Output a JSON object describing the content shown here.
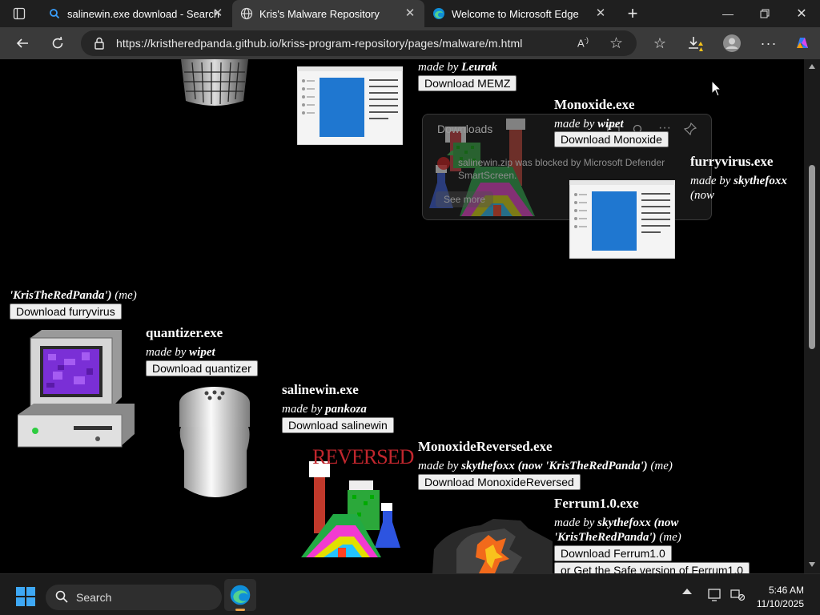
{
  "tabs": [
    {
      "title": "salinewin.exe download - Search",
      "active": false
    },
    {
      "title": "Kris's Malware Repository",
      "active": true
    },
    {
      "title": "Welcome to Microsoft Edge",
      "active": false
    }
  ],
  "address_bar": {
    "url": "https://kristheredpanda.github.io/kriss-program-repository/pages/malware/m.html"
  },
  "download_panel": {
    "title": "Downloads",
    "message": "salinewin.zip was blocked by Microsoft Defender SmartScreen.",
    "see_more": "See more"
  },
  "entries": [
    {
      "id": "memz",
      "title": "",
      "author_prefix": "made by",
      "author": "Leurak",
      "author_suffix": "",
      "button": "Download MEMZ"
    },
    {
      "id": "monoxide",
      "title": "Monoxide.exe",
      "author_prefix": "made by",
      "author": "wipet",
      "author_suffix": "",
      "button": "Download Monoxide"
    },
    {
      "id": "furryvirus",
      "title": "furryvirus.exe",
      "author_prefix": "made by",
      "author": "skythefoxx",
      "author_suffix": "(now",
      "author_line2": "'KrisTheRedPanda')",
      "author_line2_suffix": "(me)",
      "button": "Download furryvirus"
    },
    {
      "id": "quantizer",
      "title": "quantizer.exe",
      "author_prefix": "made by",
      "author": "wipet",
      "author_suffix": "",
      "button": "Download quantizer"
    },
    {
      "id": "salinewin",
      "title": "salinewin.exe",
      "author_prefix": "made by",
      "author": "pankoza",
      "author_suffix": "",
      "button": "Download salinewin"
    },
    {
      "id": "monoxidereversed",
      "title": "MonoxideReversed.exe",
      "author_prefix": "made by",
      "author": "skythefoxx (now 'KrisTheRedPanda')",
      "author_suffix": "(me)",
      "button": "Download MonoxideReversed",
      "image_text": "REVERSED"
    },
    {
      "id": "ferrum",
      "title": "Ferrum1.0.exe",
      "author_prefix": "made by",
      "author": "skythefoxx (now",
      "author_line2": "'KrisTheRedPanda')",
      "author_line2_suffix": "(me)",
      "button": "Download Ferrum1.0",
      "button2": "or Get the Safe version of Ferrum1.0"
    }
  ],
  "taskbar": {
    "search_placeholder": "Search",
    "time": "5:46 AM",
    "date": "11/10/2025"
  },
  "colors": {
    "tabbar": "#1f1f1f",
    "toolbar": "#3a3a3a",
    "page_bg": "#000000",
    "taskbar": "#1c1c1c",
    "edge_accent": "#0f8ed8"
  }
}
